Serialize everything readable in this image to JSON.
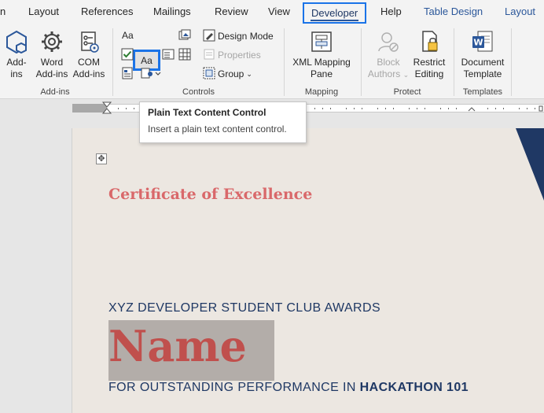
{
  "tabs": {
    "file_partial": "n",
    "layout": "Layout",
    "references": "References",
    "mailings": "Mailings",
    "review": "Review",
    "view": "View",
    "developer": "Developer",
    "help": "Help",
    "table_design": "Table Design",
    "table_layout": "Layout",
    "contextual_color": "#2b579a",
    "highlight_color": "#1a73e8"
  },
  "ribbon": {
    "addins": {
      "addins_line1": "Add-",
      "addins_line2": "ins",
      "word_addins_line1": "Word",
      "word_addins_line2": "Add-ins",
      "com_addins_line1": "COM",
      "com_addins_line2": "Add-ins",
      "group_label": "Add-ins"
    },
    "controls": {
      "aa_plain": "Aa",
      "aa_rich": "Aa",
      "design_mode": "Design Mode",
      "properties": "Properties",
      "group": "Group",
      "group_label": "Controls"
    },
    "mapping": {
      "xml_line1": "XML Mapping",
      "xml_line2": "Pane",
      "group_label": "Mapping"
    },
    "protect": {
      "block_line1": "Block",
      "block_line2": "Authors",
      "restrict_line1": "Restrict",
      "restrict_line2": "Editing",
      "group_label": "Protect"
    },
    "templates": {
      "doc_template_line1": "Document",
      "doc_template_line2": "Template",
      "group_label": "Templates"
    }
  },
  "tooltip": {
    "title": "Plain Text Content Control",
    "description": "Insert a plain text content control."
  },
  "document": {
    "certificate_title": "Certificate of Excellence",
    "club_line": "XYZ DEVELOPER STUDENT CLUB AWARDS",
    "name": "Name",
    "outstanding_prefix": "FOR OUTSTANDING PERFORMANCE IN ",
    "outstanding_event": "HACKATHON 101",
    "move_handle": "✥",
    "title_color": "#d9686a",
    "text_color": "#1f3864",
    "name_color": "#c0504d",
    "page_color": "#ece7e1",
    "shape_color": "#1f3864"
  }
}
